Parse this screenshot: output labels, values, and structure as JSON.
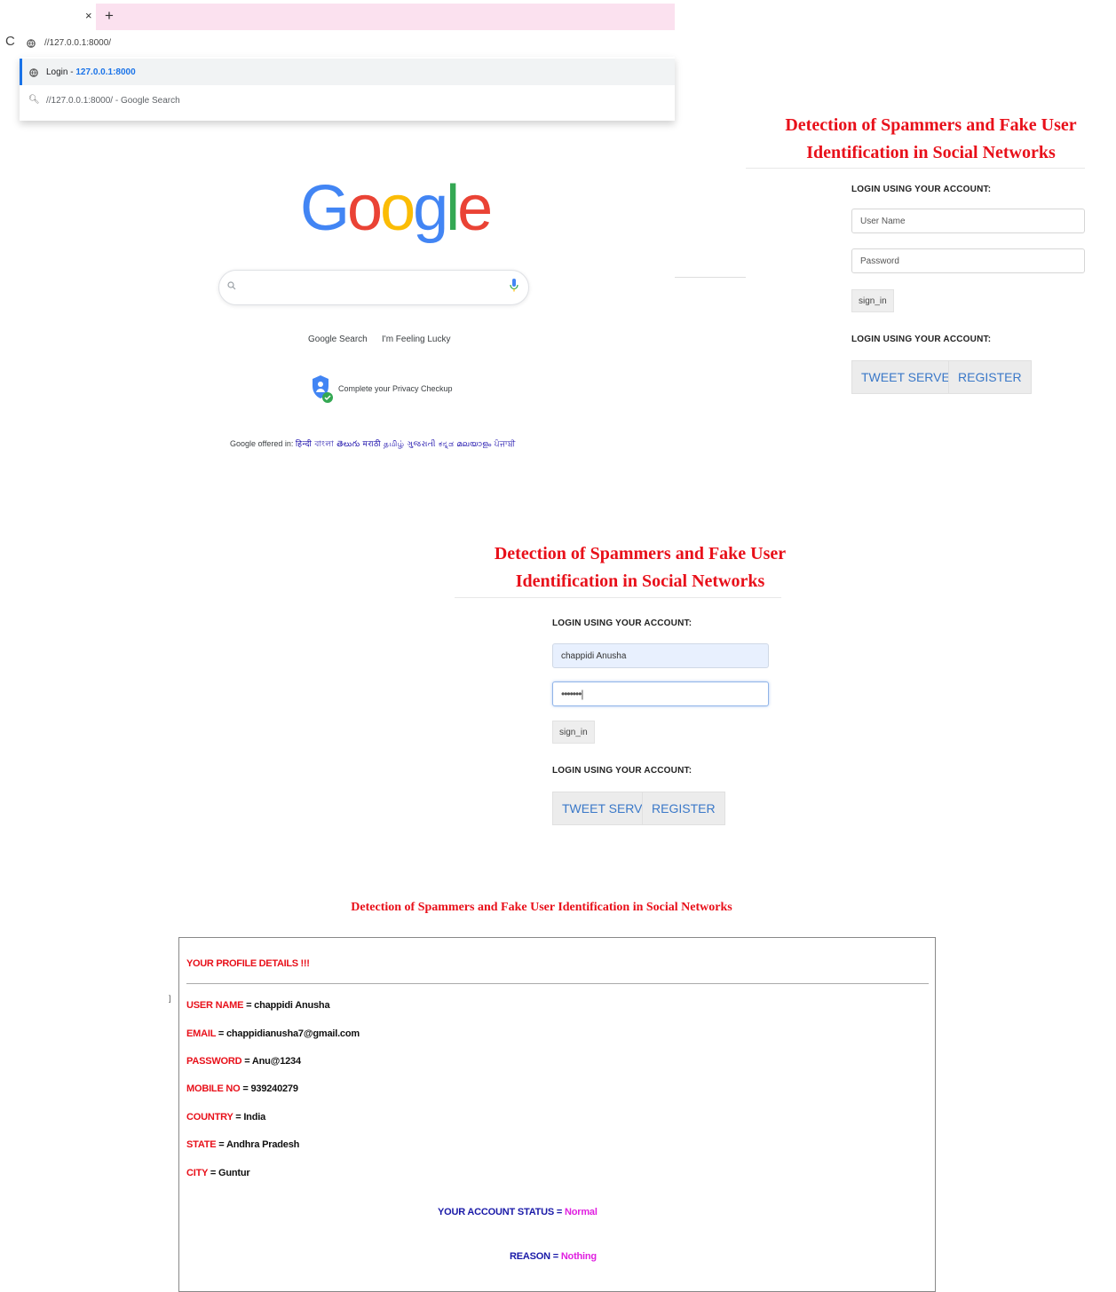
{
  "browser": {
    "tab_close": "×",
    "tab_new": "+",
    "address": "//127.0.0.1:8000/",
    "suggestion_1": {
      "title": "Login - ",
      "url": "127.0.0.1:8000"
    },
    "suggestion_2": "//127.0.0.1:8000/ - Google Search"
  },
  "google": {
    "logo_letters": [
      "G",
      "o",
      "o",
      "g",
      "l",
      "e"
    ],
    "logo_colors": [
      "#4285F4",
      "#EA4335",
      "#FBBC05",
      "#4285F4",
      "#34A853",
      "#EA4335"
    ],
    "search_button": "Google Search",
    "lucky_button": "I'm Feeling Lucky",
    "privacy": "Complete your Privacy Checkup",
    "offered_prefix": "Google offered in: ",
    "offered_langs": "हिन्दी  বাংলা  తెలుగు  मराठी  தமிழ்  ગુજરાતી  ಕನ್ನಡ  മലയാളം  ਪੰਜਾਬੀ"
  },
  "login_empty": {
    "title_line1": "Detection of Spammers and Fake User",
    "title_line2": "Identification in Social Networks",
    "caption": "LOGIN USING YOUR ACCOUNT:",
    "username_placeholder": "User Name",
    "password_placeholder": "Password",
    "sign_in": "sign_in",
    "caption2": "LOGIN USING YOUR ACCOUNT:",
    "tweet_server": "TWEET SERVER",
    "register": "REGISTER"
  },
  "login_filled": {
    "title_line1": "Detection of Spammers and Fake User",
    "title_line2": "Identification in Social Networks",
    "caption": "LOGIN USING YOUR ACCOUNT:",
    "username_value": "chappidi Anusha",
    "password_value": "•••••••|",
    "sign_in": "sign_in",
    "caption2": "LOGIN USING YOUR ACCOUNT:",
    "tweet_server": "TWEET SERVER",
    "register": "REGISTER"
  },
  "profile": {
    "title": "Detection of Spammers and Fake User Identification in Social Networks",
    "heading": "YOUR PROFILE DETAILS !!!",
    "side_mark": "]",
    "rows": [
      {
        "key": "USER NAME",
        "value": " = chappidi Anusha"
      },
      {
        "key": "EMAIL",
        "value": " = chappidianusha7@gmail.com"
      },
      {
        "key": "PASSWORD",
        "value": " = Anu@1234"
      },
      {
        "key": "MOBILE NO",
        "value": " = 939240279"
      },
      {
        "key": "COUNTRY",
        "value": " = India"
      },
      {
        "key": "STATE",
        "value": " = Andhra Pradesh"
      },
      {
        "key": "CITY",
        "value": " = Guntur"
      }
    ],
    "status_label": "YOUR ACCOUNT STATUS = ",
    "status_value": "Normal",
    "reason_label": "REASON = ",
    "reason_value": "Nothing"
  }
}
